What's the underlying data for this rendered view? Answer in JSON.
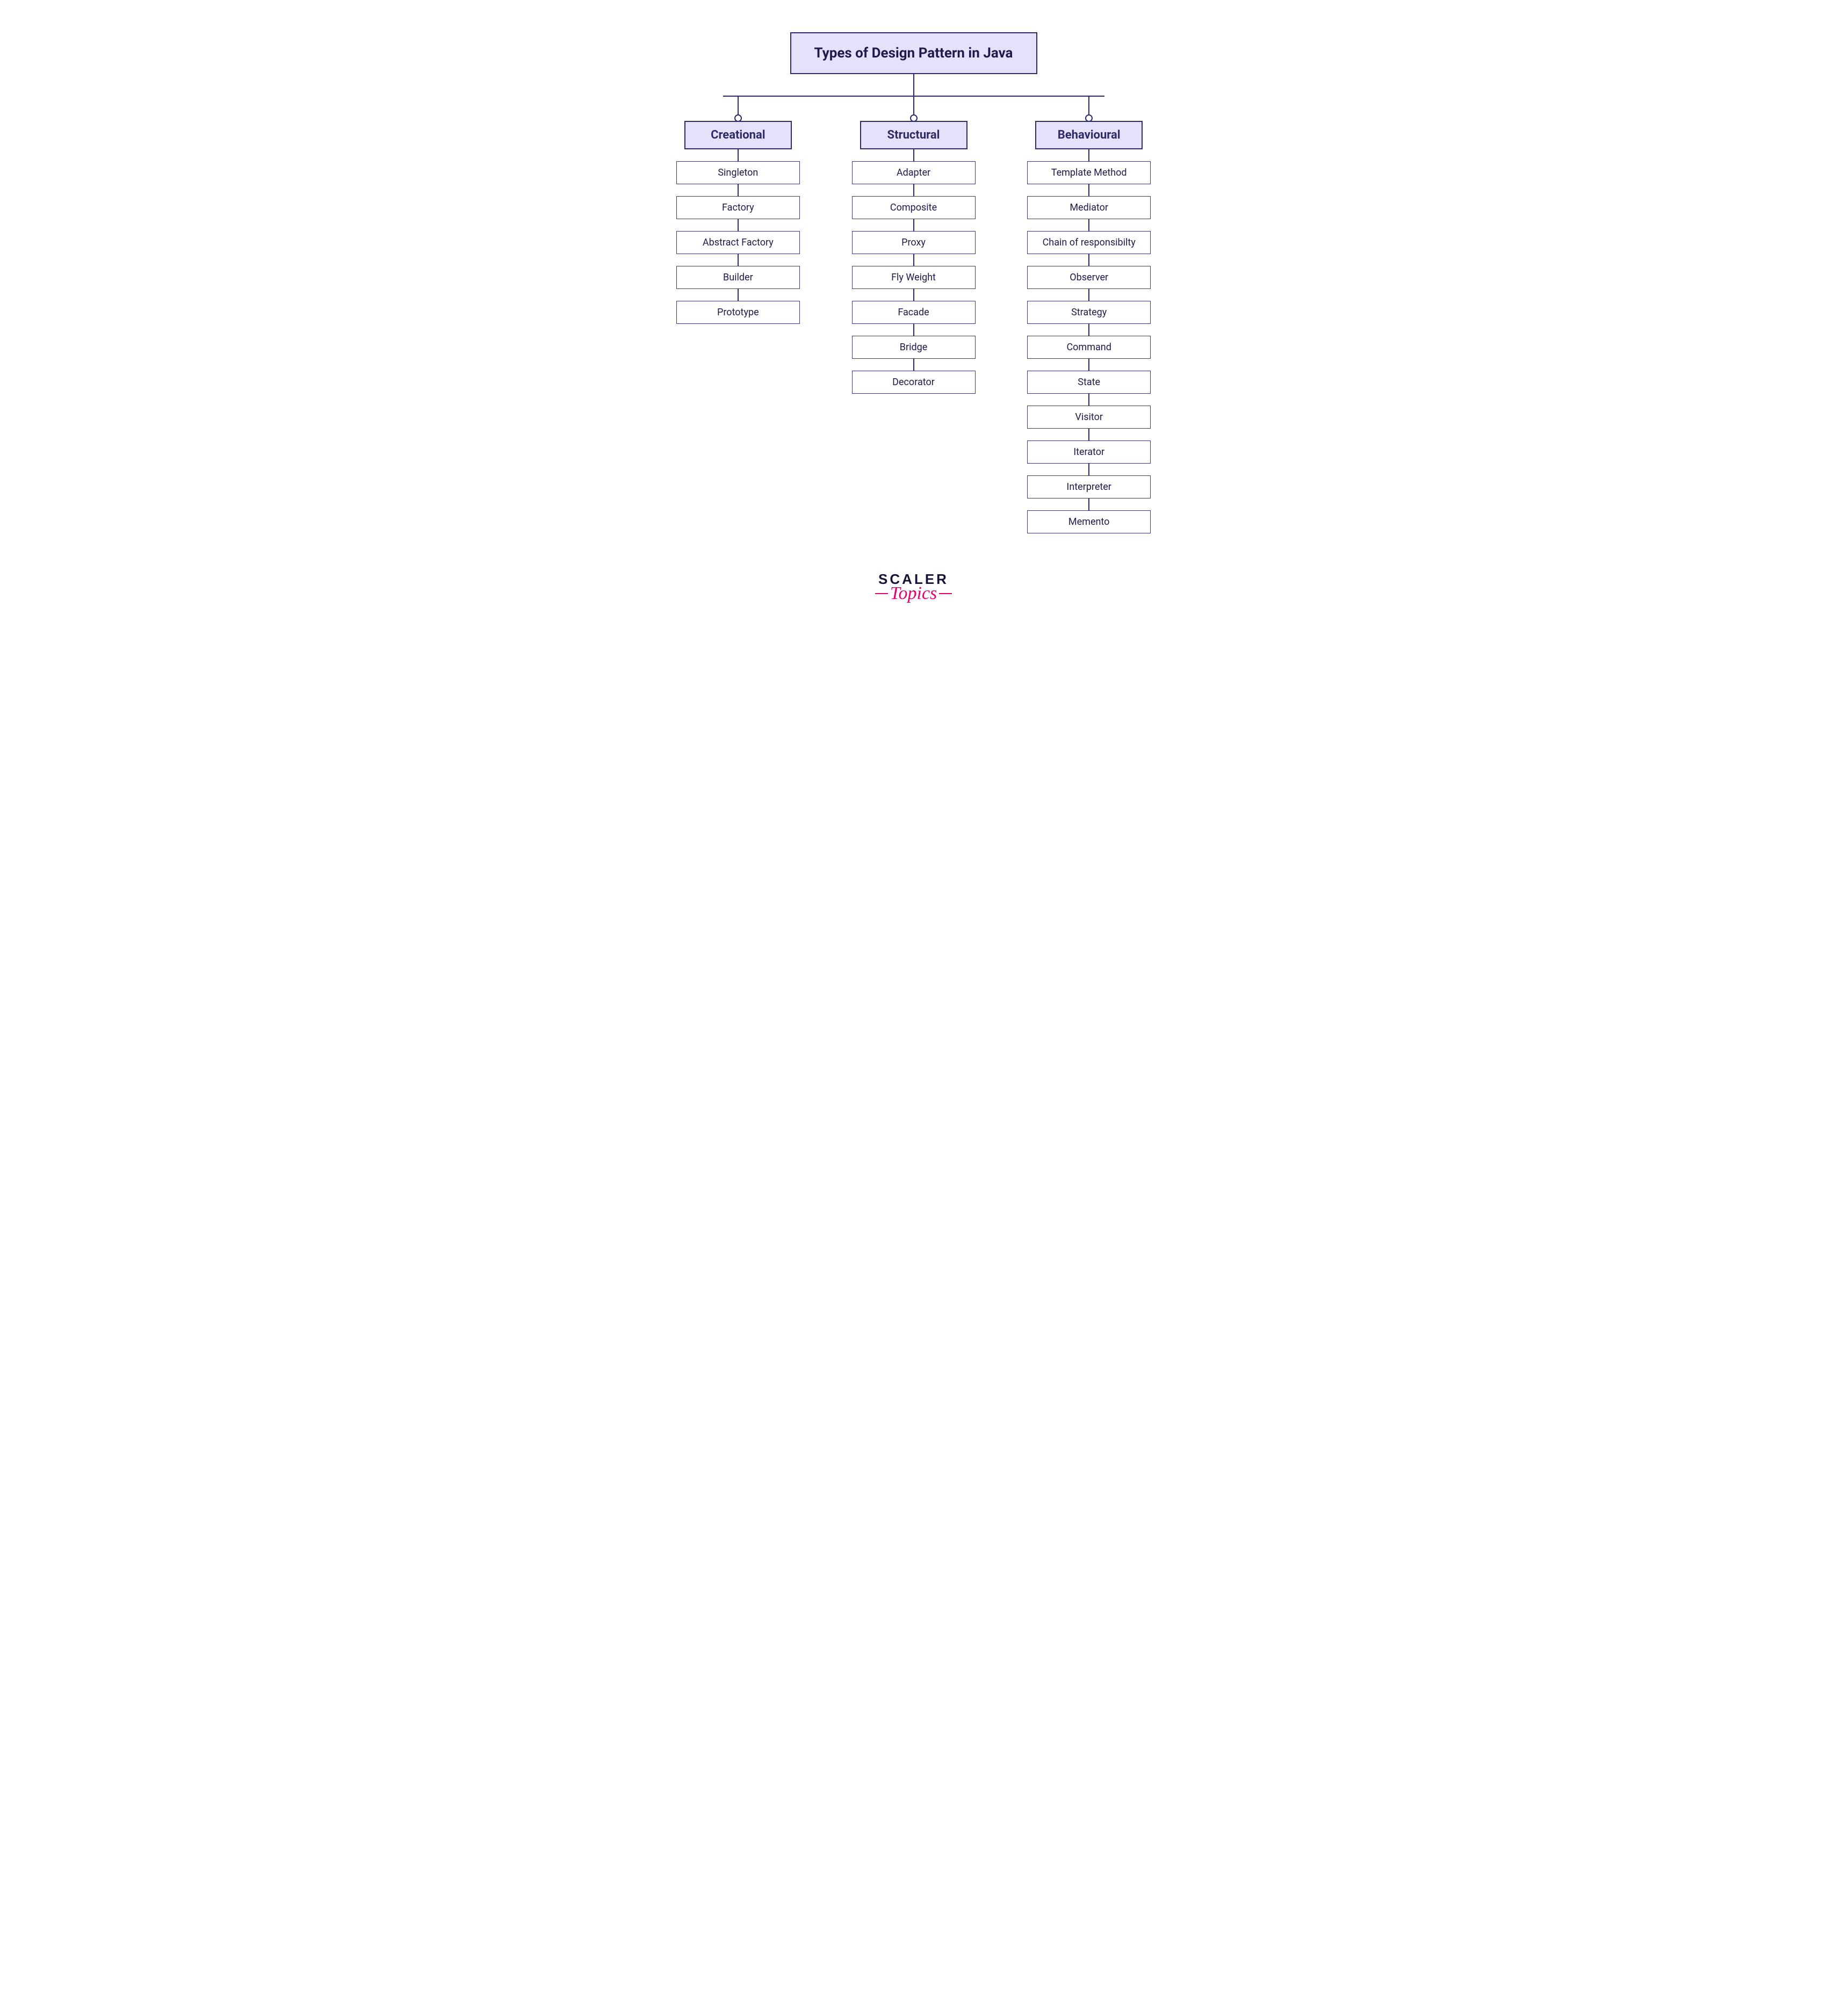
{
  "title": "Types of Design Pattern in Java",
  "columns": [
    {
      "name": "Creational",
      "items": [
        "Singleton",
        "Factory",
        "Abstract Factory",
        "Builder",
        "Prototype"
      ]
    },
    {
      "name": "Structural",
      "items": [
        "Adapter",
        "Composite",
        "Proxy",
        "Fly Weight",
        "Facade",
        "Bridge",
        "Decorator"
      ]
    },
    {
      "name": "Behavioural",
      "items": [
        "Template Method",
        "Mediator",
        "Chain of responsibilty",
        "Observer",
        "Strategy",
        "Command",
        "State",
        "Visitor",
        "Iterator",
        "Interpreter",
        "Memento"
      ]
    }
  ],
  "logo": {
    "main": "SCALER",
    "sub": "Topics"
  }
}
